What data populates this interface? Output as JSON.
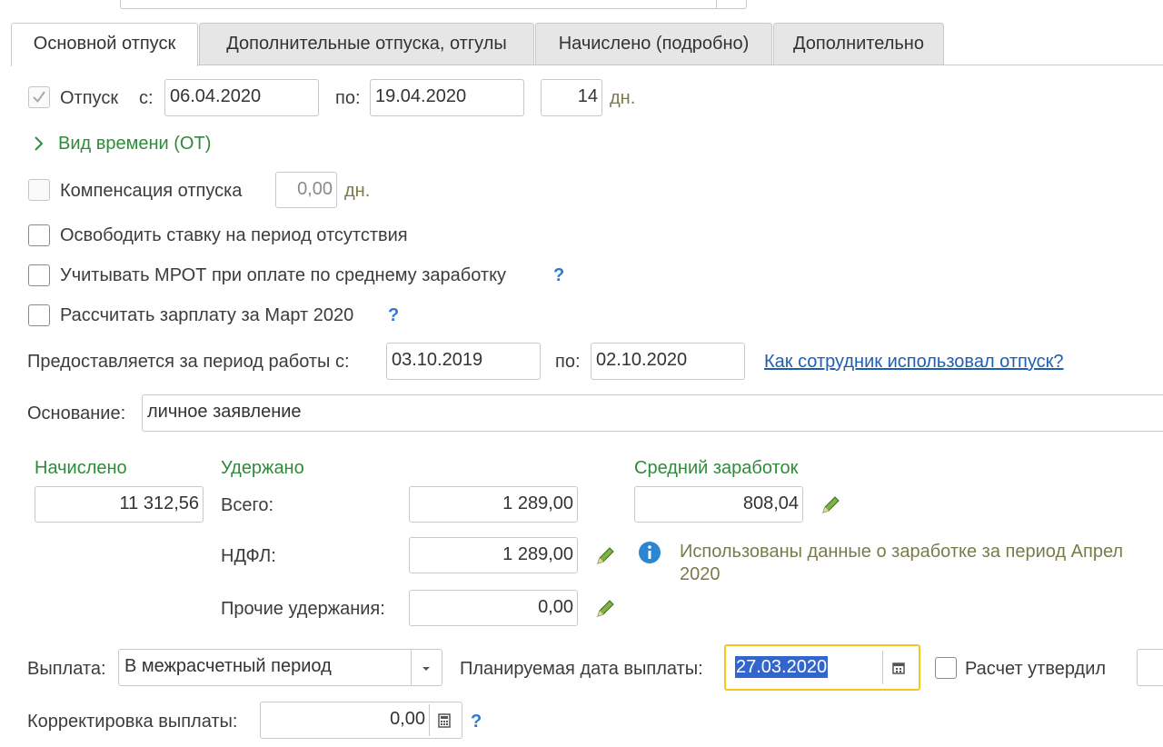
{
  "tabs": [
    "Основной отпуск",
    "Дополнительные отпуска, отгулы",
    "Начислено (подробно)",
    "Дополнительно"
  ],
  "vacation": {
    "label": "Отпуск",
    "from_label": "с:",
    "from": "06.04.2020",
    "to_label": "по:",
    "to": "19.04.2020",
    "days": "14",
    "days_unit": "дн."
  },
  "time_type": "Вид времени (ОТ)",
  "compensation": {
    "label": "Компенсация отпуска",
    "value": "0,00",
    "unit": "дн."
  },
  "options": {
    "free_rate": "Освободить ставку на период отсутствия",
    "mrot": "Учитывать МРОТ при оплате по среднему заработку",
    "calc_salary": "Рассчитать зарплату за Март 2020",
    "help": "?"
  },
  "work_period": {
    "label": "Предоставляется за период работы с:",
    "from": "03.10.2019",
    "to_label": "по:",
    "to": "02.10.2020",
    "link": "Как сотрудник использовал отпуск?"
  },
  "basis": {
    "label": "Основание:",
    "value": "личное заявление"
  },
  "accrued": {
    "label": "Начислено",
    "value": "11 312,56"
  },
  "withheld": {
    "label": "Удержано",
    "total_label": "Всего:",
    "total": "1 289,00",
    "ndfl_label": "НДФЛ:",
    "ndfl": "1 289,00",
    "other_label": "Прочие удержания:",
    "other": "0,00"
  },
  "avg": {
    "label": "Средний заработок",
    "value": "808,04",
    "info": "Использованы данные о заработке за период Апрел",
    "info2": "2020"
  },
  "payment": {
    "label": "Выплата:",
    "value": "В межрасчетный период",
    "date_label": "Планируемая дата выплаты:",
    "date": "27.03.2020",
    "approved": "Расчет утвердил"
  },
  "correction": {
    "label": "Корректировка выплаты:",
    "value": "0,00",
    "help": "?"
  },
  "colors": {
    "accent_green": "#2e8b3a",
    "link_blue": "#1e5fb4",
    "focus_yellow": "#f2c81e",
    "selection": "#3366cc"
  }
}
